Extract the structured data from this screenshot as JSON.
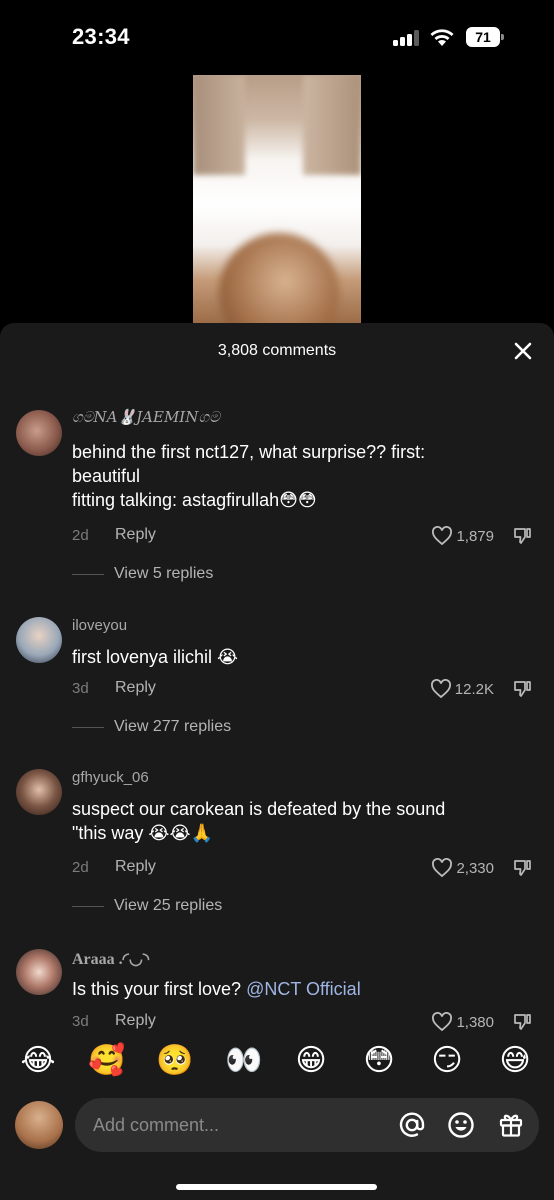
{
  "status_bar": {
    "time": "23:34",
    "battery": "71"
  },
  "comments_sheet": {
    "count_label": "3,808 comments"
  },
  "comments": [
    {
      "username": "ගමNA🐰JAEMINගම",
      "text_lines": [
        "behind the first nct127, what surprise?? first:",
        "beautiful",
        "fitting talking: astagfirullah😳😳"
      ],
      "age": "2d",
      "reply_label": "Reply",
      "likes": "1,879",
      "view_replies": "View 5 replies"
    },
    {
      "username": "iloveyou",
      "text_lines": [
        "first lovenya ilichil 😭"
      ],
      "age": "3d",
      "reply_label": "Reply",
      "likes": "12.2K",
      "view_replies": "View 277 replies"
    },
    {
      "username": "gfhyuck_06",
      "text_lines": [
        "suspect our carokean is defeated by the sound",
        "\"this way 😭😭🙏"
      ],
      "age": "2d",
      "reply_label": "Reply",
      "likes": "2,330",
      "view_replies": "View 25 replies"
    },
    {
      "username": "Araaa .◜◡◝",
      "text_prefix": "Is this your first love? ",
      "mention": "@NCT Official",
      "age": "3d",
      "reply_label": "Reply",
      "likes": "1,380"
    }
  ],
  "quick_emojis": [
    "😂",
    "🥰",
    "🥺",
    "👀",
    "😁",
    "😳",
    "😏",
    "😅"
  ],
  "composer": {
    "placeholder": "Add comment...",
    "icons": [
      "at-sign-icon",
      "emoji-icon",
      "gift-icon"
    ]
  }
}
